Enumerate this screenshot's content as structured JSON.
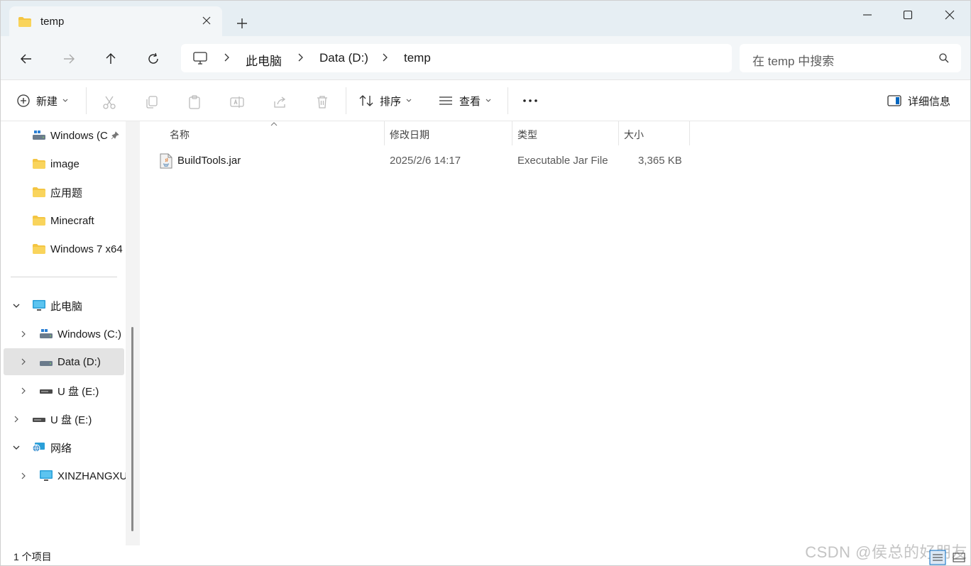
{
  "window": {
    "tab_title": "temp"
  },
  "address": {
    "crumbs": [
      "此电脑",
      "Data (D:)",
      "temp"
    ]
  },
  "search": {
    "placeholder": "在 temp 中搜索"
  },
  "toolbar": {
    "new_label": "新建",
    "sort_label": "排序",
    "view_label": "查看",
    "more_label": "···",
    "details_label": "详细信息"
  },
  "sidebar": {
    "quick": [
      {
        "label": "Windows (C",
        "icon": "drive-icon"
      },
      {
        "label": "image",
        "icon": "folder-icon"
      },
      {
        "label": "应用题",
        "icon": "folder-icon"
      },
      {
        "label": "Minecraft",
        "icon": "folder-icon"
      },
      {
        "label": "Windows 7 x64",
        "icon": "folder-icon"
      }
    ],
    "tree": [
      {
        "label": "此电脑",
        "icon": "computer-icon"
      },
      {
        "label": "Windows (C:)",
        "icon": "drive-icon"
      },
      {
        "label": "Data (D:)",
        "icon": "drive-icon"
      },
      {
        "label": "U 盘 (E:)",
        "icon": "usb-drive-icon"
      },
      {
        "label": "U 盘 (E:)",
        "icon": "usb-drive-icon"
      },
      {
        "label": "网络",
        "icon": "network-icon"
      },
      {
        "label": "XINZHANGXU",
        "icon": "computer-icon"
      }
    ]
  },
  "columns": [
    "名称",
    "修改日期",
    "类型",
    "大小"
  ],
  "files": [
    {
      "name": "BuildTools.jar",
      "date": "2025/2/6 14:17",
      "type": "Executable Jar File",
      "size": "3,365 KB"
    }
  ],
  "status": {
    "count": "1 个项目"
  },
  "watermark": "CSDN @侯总的好朋友",
  "colors": {
    "folder": "#f4c542",
    "accent": "#0067c0",
    "selected": "#e3e3e3"
  }
}
